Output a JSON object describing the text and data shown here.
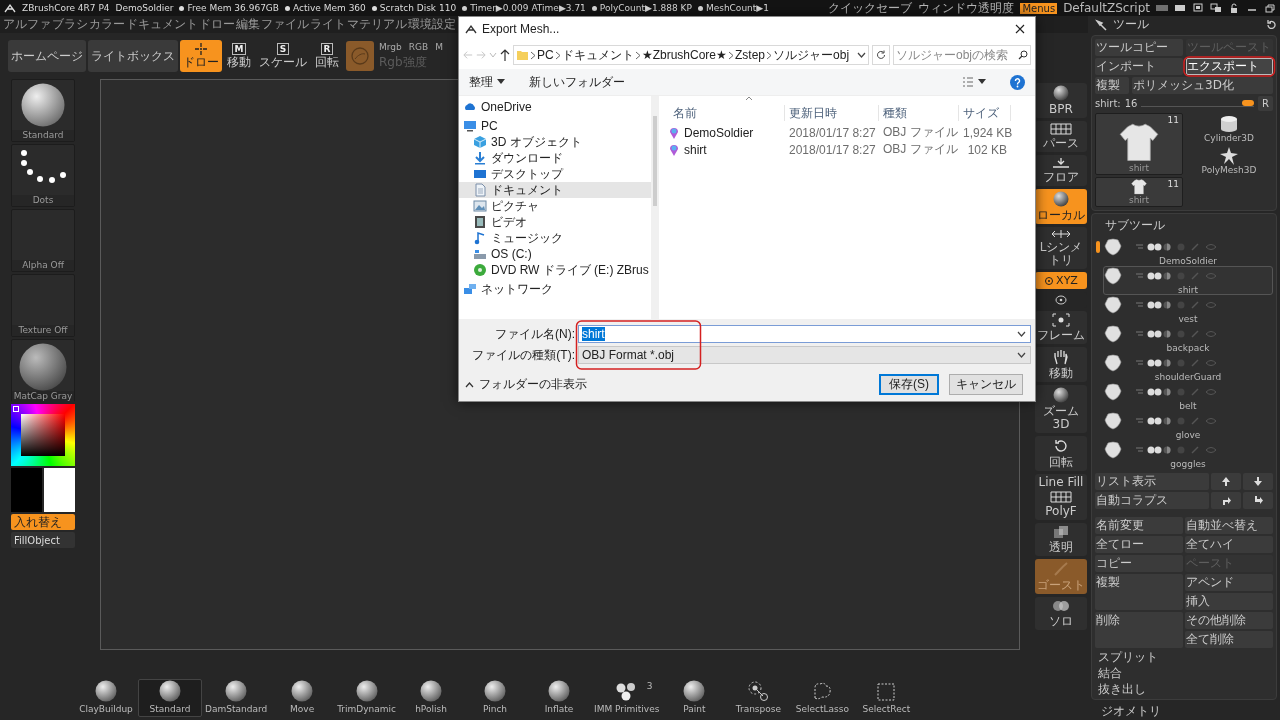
{
  "status_bar": {
    "items": [
      {
        "text": "ZBrushCore 4R7 P4",
        "kind": "title"
      },
      {
        "text": "DemoSoldier",
        "kind": "plain"
      },
      {
        "text": "Free Mem 36.967GB",
        "kind": "dot"
      },
      {
        "text": "Active Mem 360",
        "kind": "dot"
      },
      {
        "text": "Scratch Disk 110",
        "kind": "dot"
      },
      {
        "text": "Timer▶0.009 ATime▶3.71",
        "kind": "dot"
      },
      {
        "text": "PolyCount▶1.888 KP",
        "kind": "dot"
      },
      {
        "text": "MeshCount▶1",
        "kind": "dot"
      }
    ],
    "right": [
      {
        "text": "クイックセーブ",
        "kind": "plain"
      },
      {
        "text": "ウィンドウ透明度",
        "kind": "plain"
      },
      {
        "text": "Menus",
        "kind": "highlight"
      },
      {
        "text": "DefaultZScript",
        "kind": "plain"
      }
    ]
  },
  "menu_bar": {
    "items": [
      "アルファ",
      "ブラシ",
      "カラー",
      "ドキュメント",
      "ドロー",
      "編集",
      "ファイル",
      "ライト",
      "マテリアル",
      "環境設定"
    ]
  },
  "toolbar": {
    "buttons": [
      {
        "label": "ホームページ",
        "kind": "text",
        "on": false
      },
      {
        "label": "ライトボックス",
        "kind": "text",
        "on": false
      },
      {
        "label": "ドロー",
        "kind": "draw",
        "on": true
      },
      {
        "label": "移動",
        "kind": "letter",
        "letter": "M",
        "on": false
      },
      {
        "label": "スケール",
        "kind": "letter",
        "letter": "S",
        "on": false
      },
      {
        "label": "回転",
        "kind": "letter",
        "letter": "R",
        "on": false
      },
      {
        "kind": "material"
      }
    ],
    "color_modes": [
      "Mrgb",
      "RGB",
      "M"
    ],
    "intensity_label": "Rgb強度"
  },
  "left_panel": {
    "thumbnails": [
      {
        "label": "Standard",
        "kind": "brush"
      },
      {
        "label": "Dots",
        "kind": "stroke"
      },
      {
        "label": "Alpha Off",
        "kind": "empty"
      },
      {
        "label": "Texture Off",
        "kind": "empty"
      },
      {
        "label": "MatCap Gray",
        "kind": "material"
      }
    ],
    "swatches": [
      {
        "color": "#000000"
      },
      {
        "color": "#ffffff"
      }
    ],
    "swap_button": "入れ替え",
    "fill_button": "FillObject"
  },
  "right_toolbar": {
    "items": [
      {
        "label": "BPR",
        "kind": "sphere",
        "on": false,
        "disabled": false
      },
      {
        "label": "パース",
        "kind": "grid",
        "on": false,
        "disabled": false
      },
      {
        "label": "フロア",
        "kind": "floor",
        "on": false,
        "disabled": false
      },
      {
        "label": "ローカル",
        "kind": "sphere",
        "on": true,
        "disabled": false
      },
      {
        "label": "Lシンメトリ",
        "kind": "symmetry",
        "on": false,
        "disabled": false
      },
      {
        "label": "XYZ",
        "kind": "xyz",
        "on": true,
        "disabled": false
      },
      {
        "kind": "orbit",
        "on": false,
        "disabled": false
      },
      {
        "label": "フレーム",
        "kind": "frame",
        "on": false,
        "disabled": false
      },
      {
        "label": "移動",
        "kind": "hand",
        "on": false,
        "disabled": false
      },
      {
        "label": "ズーム3D",
        "kind": "sphere",
        "on": false,
        "disabled": false
      },
      {
        "label": "回転",
        "kind": "rotate",
        "on": false,
        "disabled": false
      },
      {
        "top_label": "Line Fill",
        "label": "PolyF",
        "kind": "grid",
        "on": false,
        "disabled": false
      },
      {
        "label": "透明",
        "kind": "squares",
        "on": false,
        "disabled": false
      },
      {
        "label": "ゴースト",
        "kind": "stroke",
        "on": true,
        "disabled": true
      },
      {
        "label": "ソロ",
        "kind": "circles",
        "on": false,
        "disabled": false
      }
    ]
  },
  "tool_panel": {
    "title": "ツール",
    "buttons": [
      {
        "label": "ツールコピー",
        "kind": "wide",
        "disabled": false,
        "highlighted": false
      },
      {
        "label": "ツールペースト",
        "kind": "wide",
        "disabled": true,
        "highlighted": false
      },
      {
        "label": "インポート",
        "kind": "wide",
        "disabled": false,
        "highlighted": false
      },
      {
        "label": "エクスポート",
        "kind": "wide",
        "disabled": false,
        "highlighted": true
      },
      {
        "label": "複製",
        "kind": "narrow",
        "disabled": false,
        "highlighted": false
      },
      {
        "label": "ポリメッシュ3D化",
        "kind": "wide",
        "disabled": false,
        "highlighted": false
      }
    ],
    "slider": {
      "label": "shirt:",
      "reading": "16",
      "level": 1.0
    },
    "reset_button": "R",
    "tools": [
      {
        "name": "shirt",
        "count": "11",
        "kind": "mesh_large"
      },
      {
        "name": "Cylinder3D",
        "kind": "cylinder"
      },
      {
        "name": "PolyMesh3D",
        "kind": "star"
      },
      {
        "name": "shirt",
        "count": "11",
        "kind": "mesh_small"
      }
    ],
    "subtool": {
      "title": "サブツール",
      "items": [
        {
          "name": "DemoSoldier",
          "selected": false
        },
        {
          "name": "shirt",
          "selected": true
        },
        {
          "name": "vest",
          "selected": false
        },
        {
          "name": "backpack",
          "selected": false
        },
        {
          "name": "shoulderGuard",
          "selected": false
        },
        {
          "name": "belt",
          "selected": false
        },
        {
          "name": "glove",
          "selected": false
        },
        {
          "name": "goggles",
          "selected": false
        }
      ]
    },
    "list_controls": [
      {
        "label": "リスト表示",
        "kind": "text"
      },
      {
        "kind": "up"
      },
      {
        "kind": "down"
      },
      {
        "label": "自動コラプス",
        "kind": "text"
      },
      {
        "kind": "turn-right"
      },
      {
        "kind": "turn-down"
      }
    ],
    "actions": [
      {
        "label": "名前変更",
        "kind": "single",
        "disabled": false
      },
      {
        "label": "自動並べ替え",
        "kind": "single",
        "disabled": false
      },
      {
        "label": "全てロー",
        "kind": "single",
        "disabled": false
      },
      {
        "label": "全てハイ",
        "kind": "single",
        "disabled": false
      },
      {
        "label": "コピー",
        "kind": "single",
        "disabled": false
      },
      {
        "label": "ペースト",
        "kind": "single",
        "disabled": true
      },
      {
        "label": "複製",
        "kind": "tall",
        "disabled": false
      },
      {
        "label": "アペンド",
        "kind": "single",
        "disabled": false
      },
      {
        "label": "挿入",
        "kind": "single",
        "disabled": false
      },
      {
        "label": "削除",
        "kind": "tall",
        "disabled": false
      },
      {
        "label": "その他削除",
        "kind": "single",
        "disabled": false
      },
      {
        "label": "全て削除",
        "kind": "single",
        "disabled": false
      }
    ],
    "extra_actions": [
      "スプリット",
      "結合",
      "抜き出し"
    ],
    "sections": [
      "ジオメトリ"
    ]
  },
  "brush_bar": {
    "items": [
      {
        "label": "ClayBuildup",
        "kind": "sphere",
        "selected": false
      },
      {
        "label": "Standard",
        "kind": "sphere",
        "selected": true
      },
      {
        "label": "DamStandard",
        "kind": "sphere",
        "selected": false
      },
      {
        "label": "Move",
        "kind": "sphere",
        "selected": false
      },
      {
        "label": "TrimDynamic",
        "kind": "sphere",
        "selected": false
      },
      {
        "label": "hPolish",
        "kind": "sphere",
        "selected": false
      },
      {
        "label": "Pinch",
        "kind": "sphere",
        "selected": false
      },
      {
        "label": "Inflate",
        "kind": "sphere",
        "selected": false
      },
      {
        "label": "IMM Primitives",
        "kind": "spheres",
        "badge": "3",
        "selected": false
      },
      {
        "label": "Paint",
        "kind": "sphere",
        "selected": false
      },
      {
        "label": "Transpose",
        "kind": "gizmo",
        "selected": false
      },
      {
        "label": "SelectLasso",
        "kind": "lasso",
        "selected": false
      },
      {
        "label": "SelectRect",
        "kind": "rect",
        "selected": false
      }
    ]
  },
  "dialog": {
    "title": "Export Mesh...",
    "path": [
      "PC",
      "ドキュメント",
      "★ZbrushCore★",
      "Zstep",
      "ソルジャーobj"
    ],
    "search": {
      "placeholder": "ソルジャーobjの検索"
    },
    "commands": [
      {
        "label": "整理",
        "dropdown": true
      },
      {
        "label": "新しいフォルダー",
        "dropdown": false
      }
    ],
    "nav": [
      {
        "label": "OneDrive",
        "kind": "cloud",
        "selected": false
      },
      {
        "label": "PC",
        "kind": "pc",
        "selected": false,
        "children": [
          {
            "label": "3D オブジェクト",
            "kind": "cube",
            "selected": false
          },
          {
            "label": "ダウンロード",
            "kind": "download",
            "selected": false
          },
          {
            "label": "デスクトップ",
            "kind": "desktop",
            "selected": false
          },
          {
            "label": "ドキュメント",
            "kind": "document",
            "selected": true
          },
          {
            "label": "ピクチャ",
            "kind": "picture",
            "selected": false
          },
          {
            "label": "ビデオ",
            "kind": "video",
            "selected": false
          },
          {
            "label": "ミュージック",
            "kind": "music",
            "selected": false
          },
          {
            "label": "OS (C:)",
            "kind": "drive",
            "selected": false
          },
          {
            "label": "DVD RW ドライブ (E:) ZBrus",
            "kind": "dvd",
            "selected": false
          }
        ]
      },
      {
        "label": "ネットワーク",
        "kind": "network",
        "selected": false
      }
    ],
    "columns": [
      "名前",
      "更新日時",
      "種類",
      "サイズ"
    ],
    "files": [
      {
        "name": "DemoSoldier",
        "modified": "2018/01/17 8:27",
        "type": "OBJ ファイル",
        "size": "1,924 KB"
      },
      {
        "name": "shirt",
        "modified": "2018/01/17 8:27",
        "type": "OBJ ファイル",
        "size": "102 KB"
      }
    ],
    "file_name": {
      "label": "ファイル名(N):",
      "value": "shirt"
    },
    "file_type": {
      "label": "ファイルの種類(T):",
      "value": "OBJ Format *.obj"
    },
    "hide_folders": "フォルダーの非表示",
    "buttons": [
      {
        "label": "保存(S)",
        "kind": "primary"
      },
      {
        "label": "キャンセル",
        "kind": "secondary"
      }
    ]
  },
  "annotations": [
    {
      "kind": "ellipse"
    },
    {
      "kind": "ellipse"
    }
  ]
}
